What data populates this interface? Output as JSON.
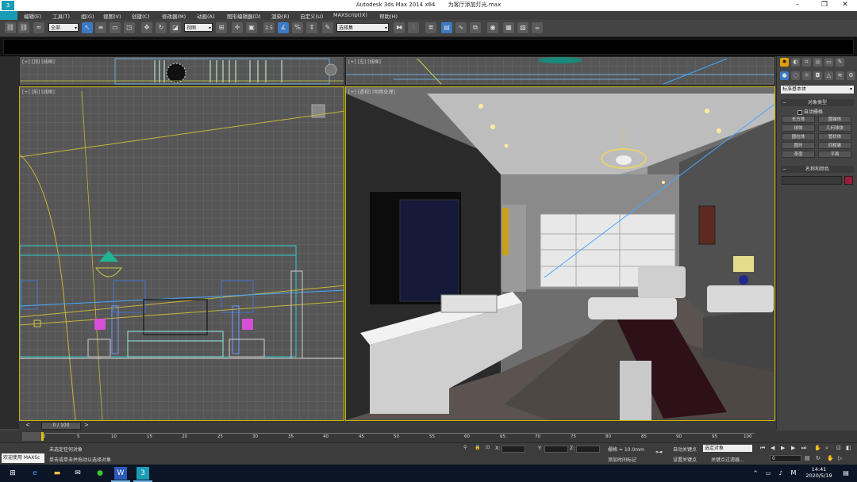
{
  "window": {
    "app_title": "Autodesk 3ds Max  2014 x64",
    "file_name": "为客厅添加灯光.max",
    "logo_glyph": "3"
  },
  "menu": [
    "编辑(E)",
    "工具(T)",
    "组(G)",
    "视图(V)",
    "创建(C)",
    "修改器(M)",
    "动画(A)",
    "图形编辑器(D)",
    "渲染(R)",
    "自定义(U)",
    "MAXScript(X)",
    "帮助(H)"
  ],
  "toolbar": {
    "selection_filter": "全部",
    "ref_coord": "视图",
    "snap_angle_label": "2.5",
    "named_selection": "选择集"
  },
  "viewports": {
    "top": {
      "label": "[+] [顶] [线框]"
    },
    "left_top": {
      "label": "[+] [前] [线框]"
    },
    "front": {
      "label": "[+] [左] [线框]"
    },
    "perspective": {
      "label": "[+] [透视] [明暗处理]"
    }
  },
  "command_panel": {
    "category": "标准基本体",
    "object_type_title": "对象类型",
    "auto_grid": "自动栅格",
    "buttons": [
      "长方体",
      "圆锥体",
      "球体",
      "几何球体",
      "圆柱体",
      "管状体",
      "圆环",
      "四棱锥",
      "茶壶",
      "平面"
    ],
    "name_color_title": "名称和颜色",
    "object_color": "#9b1b3a"
  },
  "timeline": {
    "slider_label": "0 / 100",
    "ticks": [
      "0",
      "5",
      "10",
      "15",
      "20",
      "25",
      "30",
      "35",
      "40",
      "45",
      "50",
      "55",
      "60",
      "65",
      "70",
      "75",
      "80",
      "85",
      "90",
      "95",
      "100"
    ]
  },
  "status": {
    "welcome": "欢迎使用 MAXSc",
    "line1": "未选定任何对象",
    "line2": "单击或单击并拖动以选择对象",
    "x_label": "X:",
    "y_label": "Y:",
    "z_label": "Z:",
    "grid": "栅格 = 10.0mm",
    "add_time_tag": "添加时间标记",
    "auto_key": "自动关键点",
    "selected_object": "选定对象",
    "set_key": "设置关键点",
    "key_filters": "关键点过滤器...",
    "frame_value": "0"
  },
  "taskbar": {
    "time": "14:41",
    "date": "2020/5/19"
  }
}
